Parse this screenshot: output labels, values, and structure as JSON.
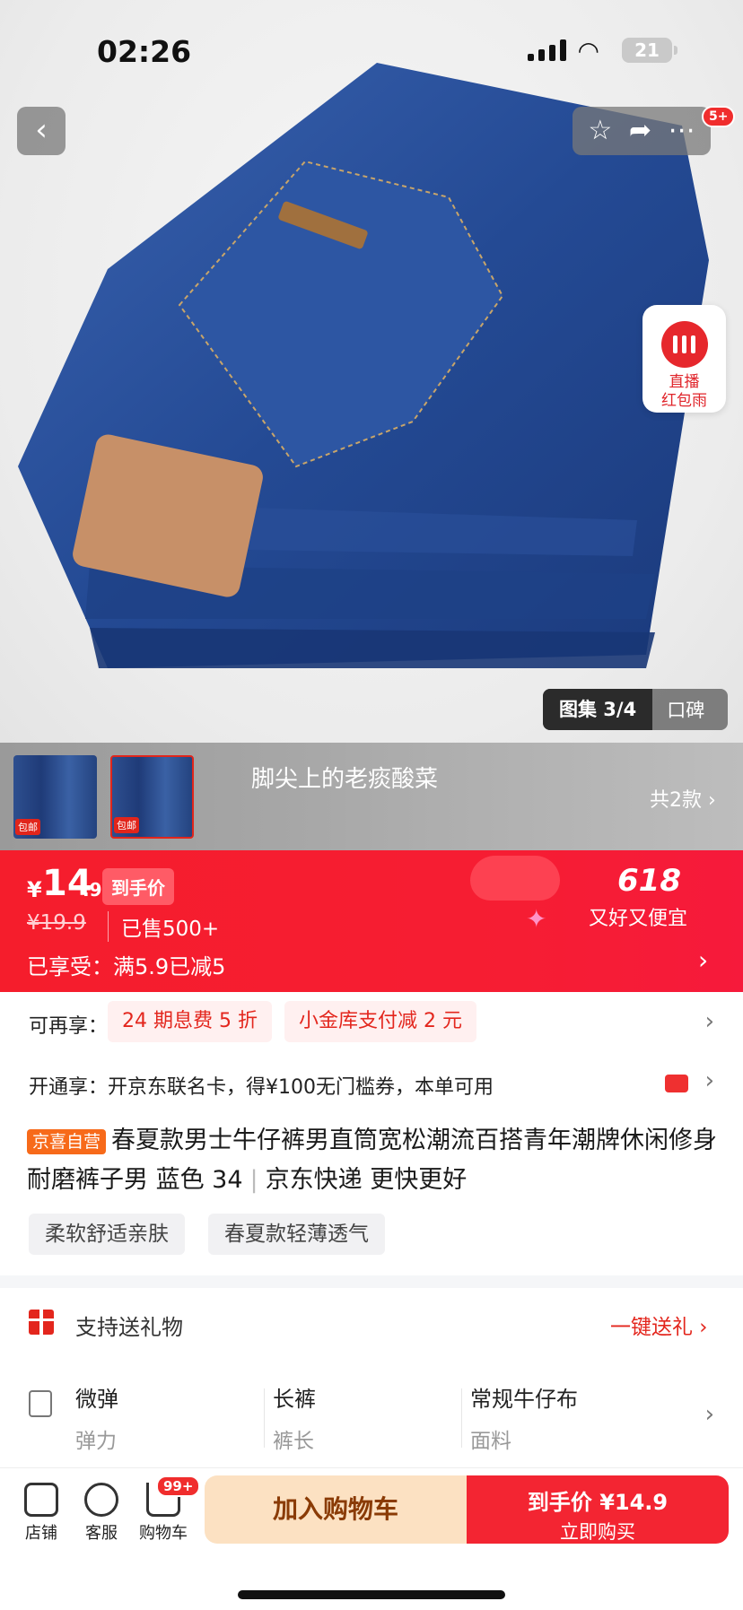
{
  "status_bar": {
    "time": "02:26",
    "battery": "21"
  },
  "header": {
    "back_icon": "chevron-left-icon",
    "toolbar_icons": [
      "star-icon",
      "share-icon",
      "more-icon"
    ],
    "badge": "5+"
  },
  "live_widget": {
    "line1": "直播",
    "line2": "红包雨"
  },
  "gallery": {
    "label": "图集 3/4",
    "reviews": "口碑"
  },
  "variant_strip": {
    "shop_name": "脚尖上的老痰酸菜",
    "count_label": "共2款 ›",
    "thumb_tag": "包邮"
  },
  "price_bar": {
    "currency": "¥",
    "price_int": "14",
    "price_dec": ".9",
    "price_tag": "到手价",
    "original_price": "¥19.9",
    "sold": "已售500+",
    "enjoyed": "已享受：满5.9已减5",
    "promo_title": "618",
    "promo_slogan": "又好又便宜"
  },
  "offers": {
    "label": "可再享：",
    "pills": [
      "24 期息费 5 折",
      "小金库支付减 2 元"
    ]
  },
  "card_offer": {
    "text": "开通享：开京东联名卡，得¥100无门槛券，本单可用"
  },
  "product": {
    "badge": "京喜自营",
    "title": "春夏款男士牛仔裤男直筒宽松潮流百搭青年潮牌休闲修身耐磨裤子男 蓝色 34",
    "delivery": "京东快递 更快更好",
    "tags": [
      "柔软舒适亲肤",
      "春夏款轻薄透气"
    ]
  },
  "gift": {
    "label": "支持送礼物",
    "action": "一键送礼 ›"
  },
  "specs": [
    {
      "value": "微弹",
      "key": "弹力"
    },
    {
      "value": "长裤",
      "key": "裤长"
    },
    {
      "value": "常规牛仔布",
      "key": "面料"
    }
  ],
  "bottom_bar": {
    "shop": "店铺",
    "service": "客服",
    "cart": "购物车",
    "cart_badge": "99+",
    "add_to_cart": "加入购物车",
    "buy_price": "到手价 ¥14.9",
    "buy_now": "立即购买"
  },
  "colors": {
    "accent_red": "#f51d2c",
    "add_cart_bg": "#fce1c2",
    "buy_bg": "#f32532"
  }
}
